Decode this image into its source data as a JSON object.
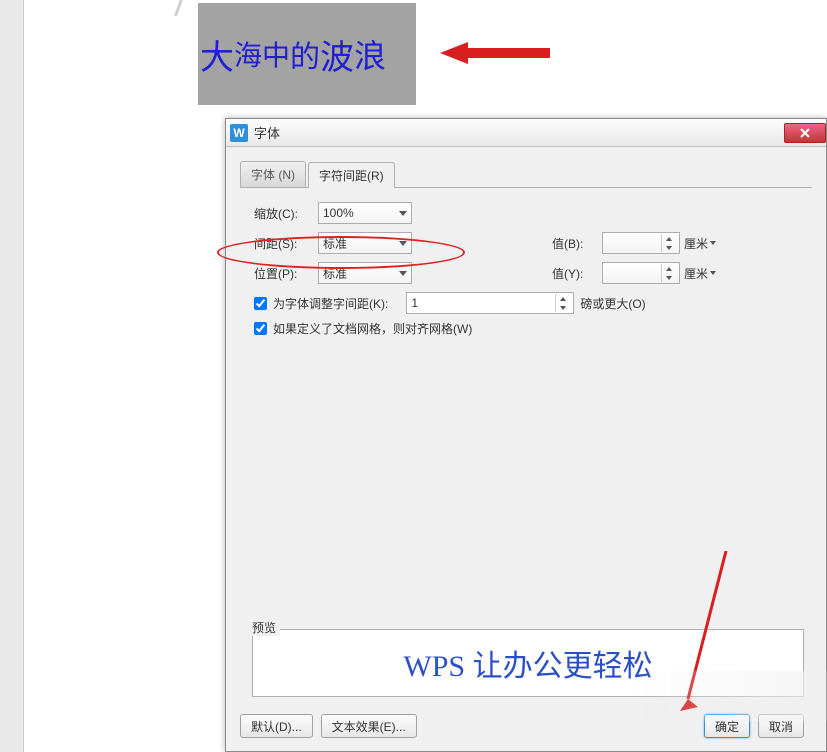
{
  "document": {
    "sample_chars": [
      "大",
      "海",
      "中",
      "的",
      "波",
      "浪"
    ]
  },
  "dialog": {
    "title": "字体",
    "icon_letter": "W",
    "tabs": {
      "font": "字体 (N)",
      "spacing": "字符间距(R)"
    },
    "fields": {
      "scaling_label": "缩放(C):",
      "scaling_value": "100%",
      "spacing_label": "间距(S):",
      "spacing_value": "标准",
      "spacing_val_label": "值(B):",
      "spacing_val": "",
      "spacing_unit": "厘米",
      "position_label": "位置(P):",
      "position_value": "标准",
      "position_val_label": "值(Y):",
      "position_val": "",
      "position_unit": "厘米"
    },
    "checks": {
      "kerning_label": "为字体调整字间距(K):",
      "kerning_value": "1",
      "kerning_unit": "磅或更大(O)",
      "grid_label": "如果定义了文档网格，则对齐网格(W)"
    },
    "preview": {
      "group_label": "预览",
      "text": "WPS 让办公更轻松"
    },
    "buttons": {
      "default": "默认(D)...",
      "effects": "文本效果(E)...",
      "ok": "确定",
      "cancel": "取消"
    }
  }
}
